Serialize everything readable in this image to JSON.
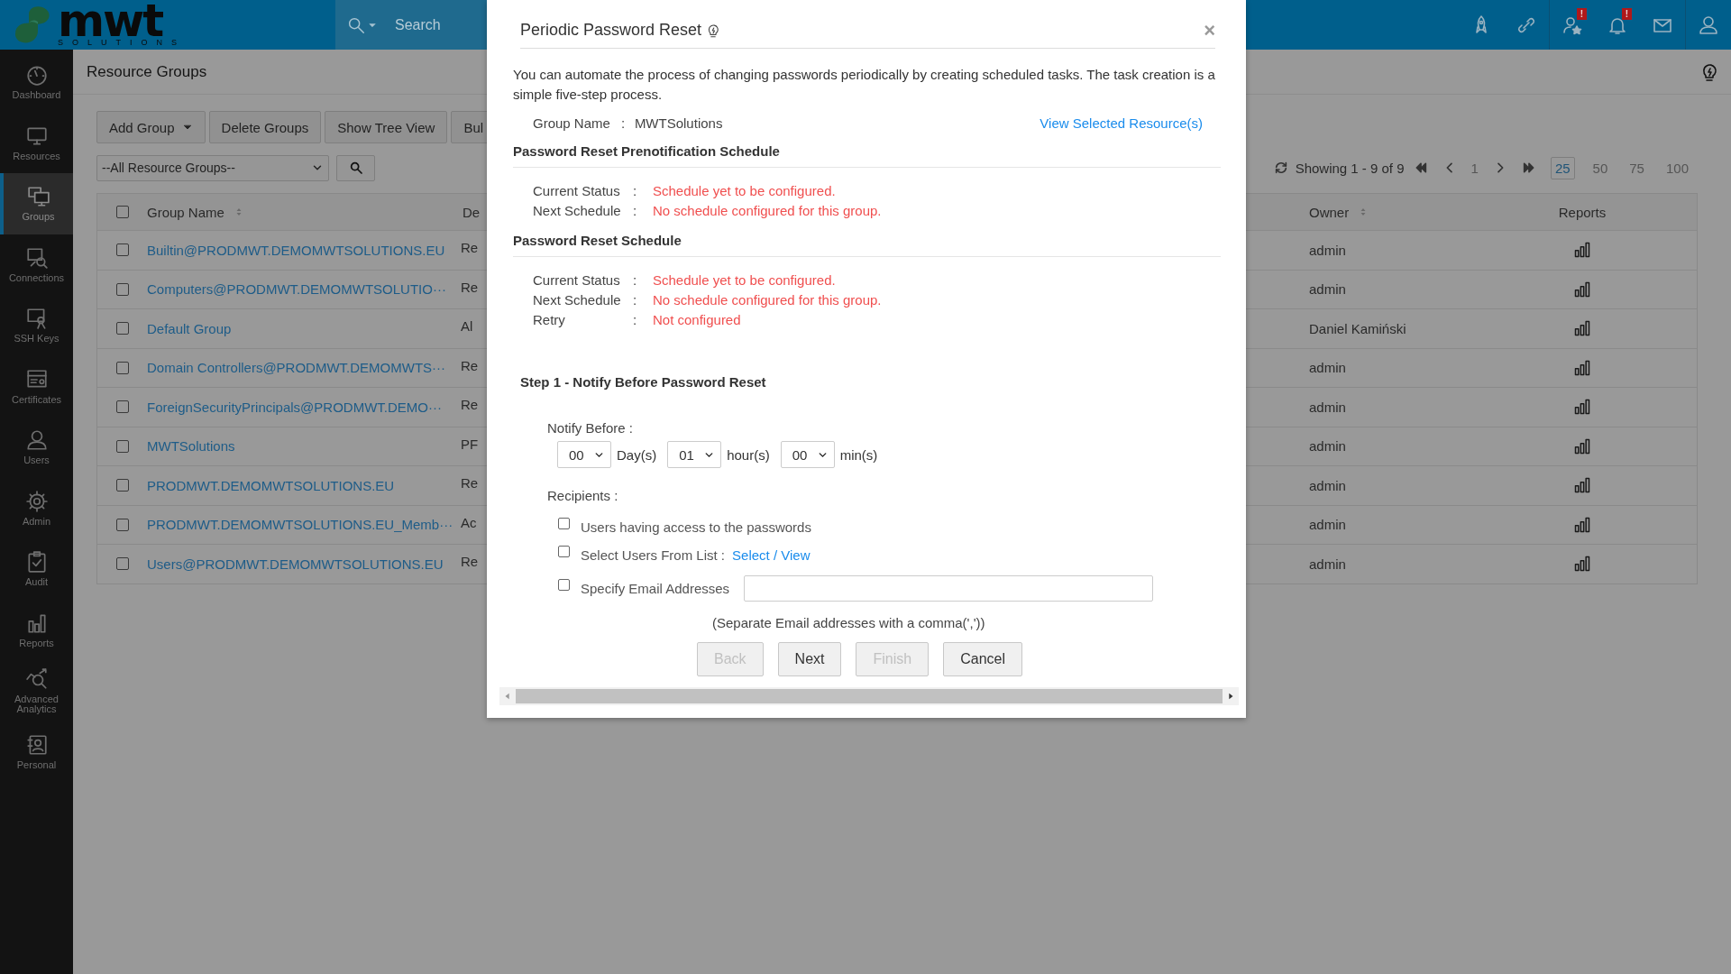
{
  "header": {
    "logo_text": "mwt",
    "logo_subtext": "SOLUTIONS",
    "search": {
      "placeholder": "Search"
    },
    "icons": [
      {
        "kind": "rocket"
      },
      {
        "kind": "link"
      },
      {
        "kind": "user-star",
        "badge": "!"
      },
      {
        "kind": "bell",
        "badge": "!"
      },
      {
        "kind": "mail"
      },
      {
        "kind": "user"
      }
    ]
  },
  "sidebar": {
    "items": [
      {
        "label": "Dashboard",
        "selected": false
      },
      {
        "label": "Resources",
        "selected": false
      },
      {
        "label": "Groups",
        "selected": true
      },
      {
        "label": "Connections",
        "selected": false
      },
      {
        "label": "SSH Keys",
        "selected": false
      },
      {
        "label": "Certificates",
        "selected": false
      },
      {
        "label": "Users",
        "selected": false
      },
      {
        "label": "Admin",
        "selected": false
      },
      {
        "label": "Audit",
        "selected": false
      },
      {
        "label": "Reports",
        "selected": false
      },
      {
        "label": "Advanced Analytics",
        "selected": false
      },
      {
        "label": "Personal",
        "selected": false
      }
    ]
  },
  "page": {
    "title": "Resource Groups",
    "toolbar": [
      {
        "label": "Add Group",
        "dropdown": true
      },
      {
        "label": "Delete Groups",
        "dropdown": false
      },
      {
        "label": "Show Tree View",
        "dropdown": false
      },
      {
        "label": "Bul",
        "dropdown": false
      }
    ],
    "filter": {
      "value": "--All Resource Groups--"
    },
    "pager": {
      "summary": "Showing 1 - 9 of 9",
      "page": "1",
      "sizes": [
        {
          "label": "25",
          "selected": true
        },
        {
          "label": "50",
          "selected": false
        },
        {
          "label": "75",
          "selected": false
        },
        {
          "label": "100",
          "selected": false
        }
      ]
    },
    "table": {
      "select_all_checked": false,
      "columns": [
        "Group Name",
        "De",
        "Owner",
        "Reports"
      ],
      "rows": [
        {
          "checked": false,
          "name": "Builtin@PRODMWT.DEMOMWTSOLUTIONS.EU",
          "column_3": "Re",
          "owner": "admin"
        },
        {
          "checked": false,
          "name": "Computers@PRODMWT.DEMOMWTSOLUTIO···",
          "column_3": "Re",
          "owner": "admin"
        },
        {
          "checked": false,
          "name": "Default Group",
          "column_3": "Al",
          "owner": "Daniel Kamiński"
        },
        {
          "checked": false,
          "name": "Domain Controllers@PRODMWT.DEMOMWTS···",
          "column_3": "Re",
          "owner": "admin"
        },
        {
          "checked": false,
          "name": "ForeignSecurityPrincipals@PRODMWT.DEMO···",
          "column_3": "Re",
          "owner": "admin"
        },
        {
          "checked": false,
          "name": "MWTSolutions",
          "column_3": "PF",
          "owner": "admin"
        },
        {
          "checked": false,
          "name": "PRODMWT.DEMOMWTSOLUTIONS.EU",
          "column_3": "Re",
          "owner": "admin"
        },
        {
          "checked": false,
          "name": "PRODMWT.DEMOMWTSOLUTIONS.EU_Memb···",
          "column_3": "Ac",
          "owner": "admin"
        },
        {
          "checked": false,
          "name": "Users@PRODMWT.DEMOMWTSOLUTIONS.EU",
          "column_3": "Re",
          "owner": "admin"
        }
      ]
    }
  },
  "dialog": {
    "title": "Periodic Password Reset",
    "close": "×",
    "intro": "You can automate the process of changing passwords periodically by creating scheduled tasks. The task creation is a simple five-step process.",
    "group_label": "Group Name",
    "group_colon": ":",
    "group_value": "MWTSolutions",
    "view_link": "View Selected Resource(s)",
    "sections": [
      {
        "heading": "Password Reset Prenotification Schedule",
        "rows": [
          {
            "label": "Current Status",
            "colon": ":",
            "value": "Schedule yet to be configured."
          },
          {
            "label": "Next Schedule",
            "colon": ":",
            "value": "No schedule configured for this group."
          }
        ]
      },
      {
        "heading": "Password Reset Schedule",
        "rows": [
          {
            "label": "Current Status",
            "colon": ":",
            "value": "Schedule yet to be configured."
          },
          {
            "label": "Next Schedule",
            "colon": ":",
            "value": "No schedule configured for this group."
          },
          {
            "label": "Retry",
            "colon": ":",
            "value": "Not configured"
          }
        ]
      }
    ],
    "step_title": "Step 1 - Notify Before Password Reset",
    "notify_label": "Notify Before :",
    "notify_fields": [
      {
        "value": "00",
        "unit": "Day(s)"
      },
      {
        "value": "01",
        "unit": "hour(s)"
      },
      {
        "value": "00",
        "unit": "min(s)"
      }
    ],
    "recipients_label": "Recipients :",
    "recipients": [
      {
        "kind": "plain",
        "label": "Users having access to the passwords",
        "checked": false
      },
      {
        "kind": "link",
        "label": "Select Users From List :",
        "link": "Select / View",
        "checked": false
      },
      {
        "kind": "email",
        "label": "Specify Email Addresses",
        "checked": false
      }
    ],
    "note": "(Separate Email addresses with a comma(','))",
    "buttons": [
      {
        "label": "Back",
        "disabled": true
      },
      {
        "label": "Next",
        "disabled": false
      },
      {
        "label": "Finish",
        "disabled": true
      },
      {
        "label": "Cancel",
        "disabled": false
      }
    ]
  }
}
